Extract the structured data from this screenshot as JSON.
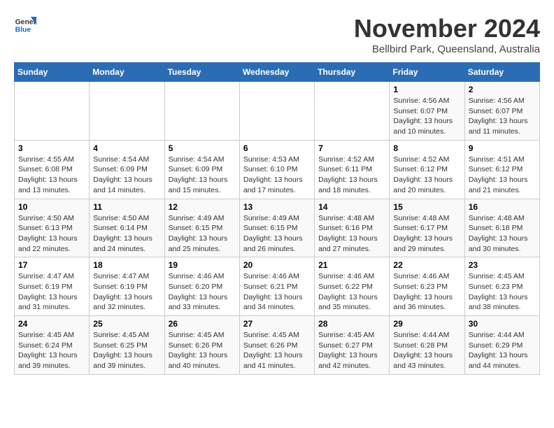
{
  "header": {
    "logo_general": "General",
    "logo_blue": "Blue",
    "month_title": "November 2024",
    "location": "Bellbird Park, Queensland, Australia"
  },
  "days_of_week": [
    "Sunday",
    "Monday",
    "Tuesday",
    "Wednesday",
    "Thursday",
    "Friday",
    "Saturday"
  ],
  "weeks": [
    [
      {
        "day": "",
        "detail": ""
      },
      {
        "day": "",
        "detail": ""
      },
      {
        "day": "",
        "detail": ""
      },
      {
        "day": "",
        "detail": ""
      },
      {
        "day": "",
        "detail": ""
      },
      {
        "day": "1",
        "detail": "Sunrise: 4:56 AM\nSunset: 6:07 PM\nDaylight: 13 hours\nand 10 minutes."
      },
      {
        "day": "2",
        "detail": "Sunrise: 4:56 AM\nSunset: 6:07 PM\nDaylight: 13 hours\nand 11 minutes."
      }
    ],
    [
      {
        "day": "3",
        "detail": "Sunrise: 4:55 AM\nSunset: 6:08 PM\nDaylight: 13 hours\nand 13 minutes."
      },
      {
        "day": "4",
        "detail": "Sunrise: 4:54 AM\nSunset: 6:09 PM\nDaylight: 13 hours\nand 14 minutes."
      },
      {
        "day": "5",
        "detail": "Sunrise: 4:54 AM\nSunset: 6:09 PM\nDaylight: 13 hours\nand 15 minutes."
      },
      {
        "day": "6",
        "detail": "Sunrise: 4:53 AM\nSunset: 6:10 PM\nDaylight: 13 hours\nand 17 minutes."
      },
      {
        "day": "7",
        "detail": "Sunrise: 4:52 AM\nSunset: 6:11 PM\nDaylight: 13 hours\nand 18 minutes."
      },
      {
        "day": "8",
        "detail": "Sunrise: 4:52 AM\nSunset: 6:12 PM\nDaylight: 13 hours\nand 20 minutes."
      },
      {
        "day": "9",
        "detail": "Sunrise: 4:51 AM\nSunset: 6:12 PM\nDaylight: 13 hours\nand 21 minutes."
      }
    ],
    [
      {
        "day": "10",
        "detail": "Sunrise: 4:50 AM\nSunset: 6:13 PM\nDaylight: 13 hours\nand 22 minutes."
      },
      {
        "day": "11",
        "detail": "Sunrise: 4:50 AM\nSunset: 6:14 PM\nDaylight: 13 hours\nand 24 minutes."
      },
      {
        "day": "12",
        "detail": "Sunrise: 4:49 AM\nSunset: 6:15 PM\nDaylight: 13 hours\nand 25 minutes."
      },
      {
        "day": "13",
        "detail": "Sunrise: 4:49 AM\nSunset: 6:15 PM\nDaylight: 13 hours\nand 26 minutes."
      },
      {
        "day": "14",
        "detail": "Sunrise: 4:48 AM\nSunset: 6:16 PM\nDaylight: 13 hours\nand 27 minutes."
      },
      {
        "day": "15",
        "detail": "Sunrise: 4:48 AM\nSunset: 6:17 PM\nDaylight: 13 hours\nand 29 minutes."
      },
      {
        "day": "16",
        "detail": "Sunrise: 4:48 AM\nSunset: 6:18 PM\nDaylight: 13 hours\nand 30 minutes."
      }
    ],
    [
      {
        "day": "17",
        "detail": "Sunrise: 4:47 AM\nSunset: 6:19 PM\nDaylight: 13 hours\nand 31 minutes."
      },
      {
        "day": "18",
        "detail": "Sunrise: 4:47 AM\nSunset: 6:19 PM\nDaylight: 13 hours\nand 32 minutes."
      },
      {
        "day": "19",
        "detail": "Sunrise: 4:46 AM\nSunset: 6:20 PM\nDaylight: 13 hours\nand 33 minutes."
      },
      {
        "day": "20",
        "detail": "Sunrise: 4:46 AM\nSunset: 6:21 PM\nDaylight: 13 hours\nand 34 minutes."
      },
      {
        "day": "21",
        "detail": "Sunrise: 4:46 AM\nSunset: 6:22 PM\nDaylight: 13 hours\nand 35 minutes."
      },
      {
        "day": "22",
        "detail": "Sunrise: 4:46 AM\nSunset: 6:23 PM\nDaylight: 13 hours\nand 36 minutes."
      },
      {
        "day": "23",
        "detail": "Sunrise: 4:45 AM\nSunset: 6:23 PM\nDaylight: 13 hours\nand 38 minutes."
      }
    ],
    [
      {
        "day": "24",
        "detail": "Sunrise: 4:45 AM\nSunset: 6:24 PM\nDaylight: 13 hours\nand 39 minutes."
      },
      {
        "day": "25",
        "detail": "Sunrise: 4:45 AM\nSunset: 6:25 PM\nDaylight: 13 hours\nand 39 minutes."
      },
      {
        "day": "26",
        "detail": "Sunrise: 4:45 AM\nSunset: 6:26 PM\nDaylight: 13 hours\nand 40 minutes."
      },
      {
        "day": "27",
        "detail": "Sunrise: 4:45 AM\nSunset: 6:26 PM\nDaylight: 13 hours\nand 41 minutes."
      },
      {
        "day": "28",
        "detail": "Sunrise: 4:45 AM\nSunset: 6:27 PM\nDaylight: 13 hours\nand 42 minutes."
      },
      {
        "day": "29",
        "detail": "Sunrise: 4:44 AM\nSunset: 6:28 PM\nDaylight: 13 hours\nand 43 minutes."
      },
      {
        "day": "30",
        "detail": "Sunrise: 4:44 AM\nSunset: 6:29 PM\nDaylight: 13 hours\nand 44 minutes."
      }
    ]
  ]
}
